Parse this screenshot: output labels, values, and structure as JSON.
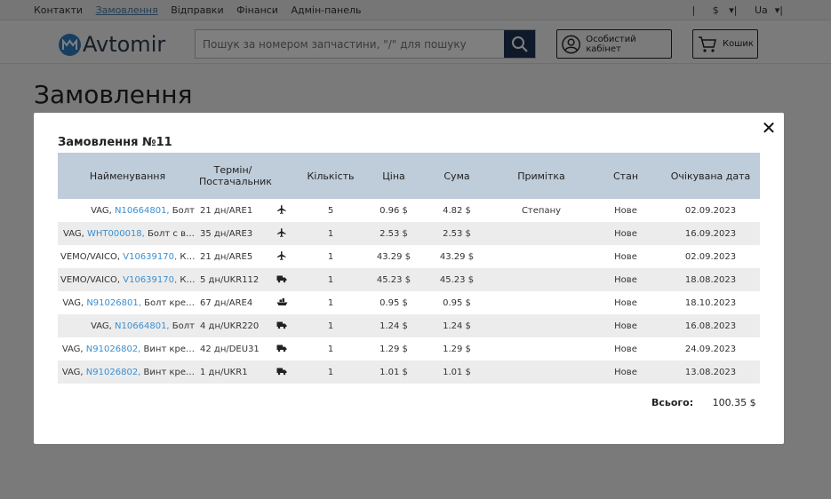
{
  "topnav": [
    "Контакти",
    "Замовлення",
    "Відправки",
    "Фінанси",
    "Адмін-панель"
  ],
  "topnav_active": 1,
  "currency": "$",
  "language": "Ua",
  "logo_text": "Avtomir",
  "search": {
    "placeholder": "Пошук за номером запчастини, \"/\" для пошуку"
  },
  "cabinet_label": "Особистий кабінет",
  "cart_label": "Кошик",
  "page_title": "Замовлення",
  "modal": {
    "title": "Замовлення №11",
    "columns": [
      "Найменування",
      "Термін/ Постачальник",
      "",
      "Кількість",
      "Ціна",
      "Сума",
      "Примітка",
      "Стан",
      "Очікувана дата"
    ],
    "rows": [
      {
        "brand": "VAG,",
        "code": "N10664801,",
        "desc": "Болт",
        "term": "21 дн/ARE1",
        "delivery_icon": "plane-icon",
        "qty": "5",
        "price": "0.96 $",
        "sum": "4.82 $",
        "note": "Степану",
        "status": "Нове",
        "date": "02.09.2023"
      },
      {
        "brand": "VAG,",
        "code": "WHT000018,",
        "desc": "Болт с в…",
        "term": "35 дн/ARE3",
        "delivery_icon": "plane-icon",
        "qty": "1",
        "price": "2.53 $",
        "sum": "2.53 $",
        "note": "",
        "status": "Нове",
        "date": "16.09.2023"
      },
      {
        "brand": "VEMO/VAICO,",
        "code": "V10639170,",
        "desc": "К…",
        "term": "21 дн/ARE5",
        "delivery_icon": "plane-icon",
        "qty": "1",
        "price": "43.29 $",
        "sum": "43.29 $",
        "note": "",
        "status": "Нове",
        "date": "02.09.2023"
      },
      {
        "brand": "VEMO/VAICO,",
        "code": "V10639170,",
        "desc": "К…",
        "term": "5 дн/UKR112",
        "delivery_icon": "truck-icon",
        "qty": "1",
        "price": "45.23 $",
        "sum": "45.23 $",
        "note": "",
        "status": "Нове",
        "date": "18.08.2023"
      },
      {
        "brand": "VAG,",
        "code": "N91026801,",
        "desc": "Болт кре…",
        "term": "67 дн/ARE4",
        "delivery_icon": "ship-icon",
        "qty": "1",
        "price": "0.95 $",
        "sum": "0.95 $",
        "note": "",
        "status": "Нове",
        "date": "18.10.2023"
      },
      {
        "brand": "VAG,",
        "code": "N10664801,",
        "desc": "Болт",
        "term": "4 дн/UKR220",
        "delivery_icon": "truck-icon",
        "qty": "1",
        "price": "1.24 $",
        "sum": "1.24 $",
        "note": "",
        "status": "Нове",
        "date": "16.08.2023"
      },
      {
        "brand": "VAG,",
        "code": "N91026802,",
        "desc": "Винт кре…",
        "term": "42 дн/DEU31",
        "delivery_icon": "truck-icon",
        "qty": "1",
        "price": "1.29 $",
        "sum": "1.29 $",
        "note": "",
        "status": "Нове",
        "date": "24.09.2023"
      },
      {
        "brand": "VAG,",
        "code": "N91026802,",
        "desc": "Винт кре…",
        "term": "1 дн/UKR1",
        "delivery_icon": "truck-icon",
        "qty": "1",
        "price": "1.01 $",
        "sum": "1.01 $",
        "note": "",
        "status": "Нове",
        "date": "13.08.2023"
      }
    ],
    "total_label": "Всього:",
    "total_value": "100.35 $"
  },
  "colors": {
    "accent": "#3a8fd0",
    "header_row": "#bfccd9",
    "search_button": "#1c3552"
  }
}
